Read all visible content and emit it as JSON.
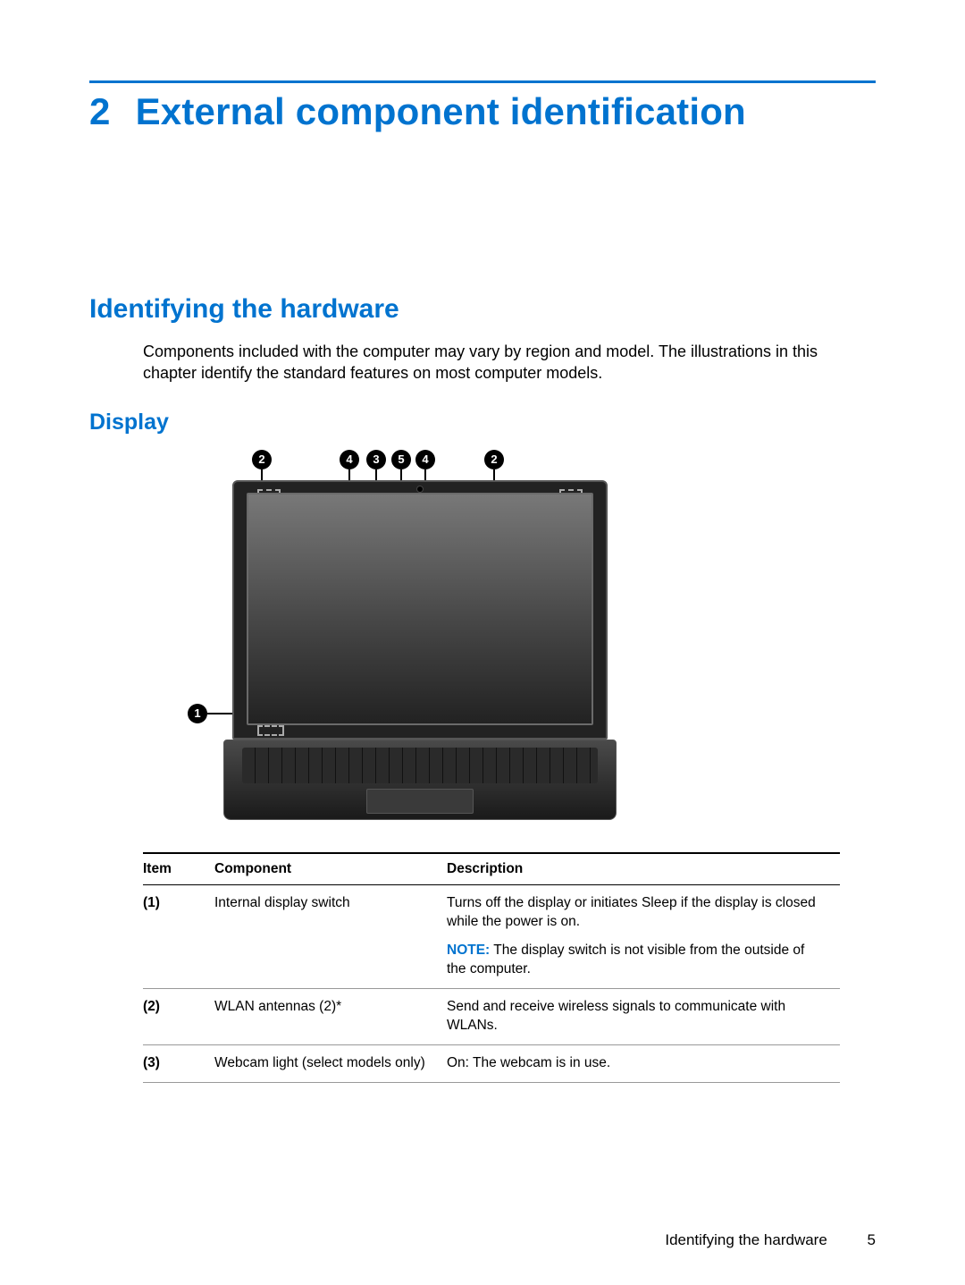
{
  "chapter": {
    "number": "2",
    "title": "External component identification"
  },
  "section": {
    "title": "Identifying the hardware",
    "body": "Components included with the computer may vary by region and model. The illustrations in this chapter identify the standard features on most computer models."
  },
  "subsection": {
    "title": "Display"
  },
  "callouts": {
    "top": [
      "2",
      "4",
      "3",
      "5",
      "4",
      "2"
    ],
    "side": "1"
  },
  "table": {
    "headers": {
      "item": "Item",
      "component": "Component",
      "description": "Description"
    },
    "rows": [
      {
        "item": "(1)",
        "component": "Internal display switch",
        "desc1": "Turns off the display or initiates Sleep if the display is closed while the power is on.",
        "note_label": "NOTE:",
        "note_text": "The display switch is not visible from the outside of the computer."
      },
      {
        "item": "(2)",
        "component": "WLAN antennas (2)*",
        "desc1": "Send and receive wireless signals to communicate with WLANs."
      },
      {
        "item": "(3)",
        "component": "Webcam light (select models only)",
        "desc1": "On: The webcam is in use."
      }
    ]
  },
  "footer": {
    "text": "Identifying the hardware",
    "page": "5"
  }
}
